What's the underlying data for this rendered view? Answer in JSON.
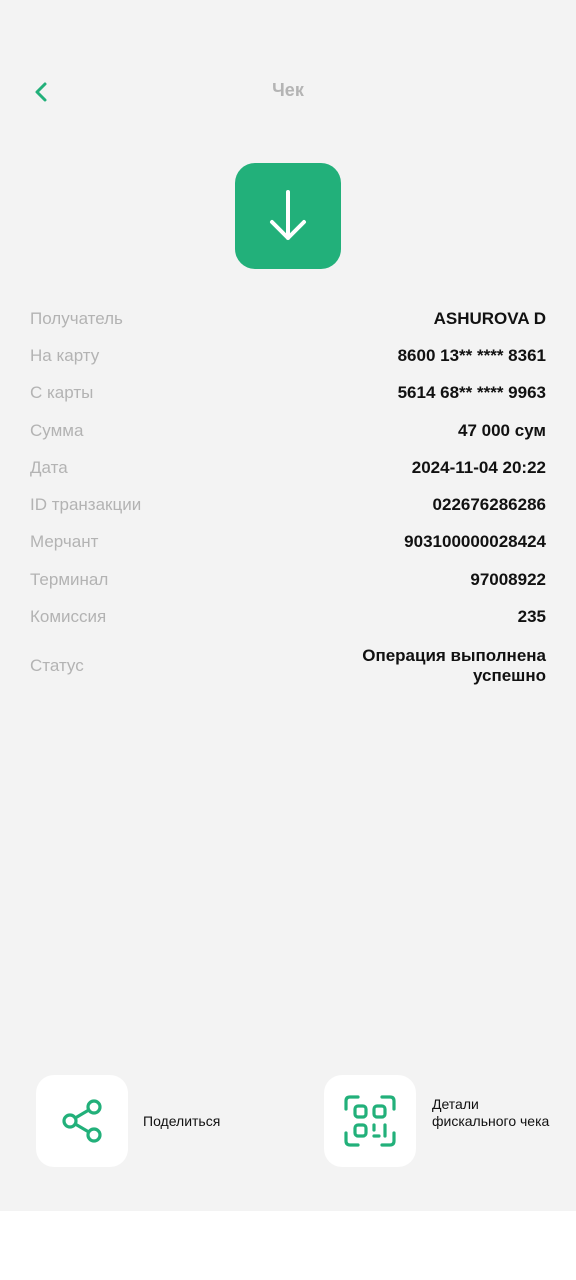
{
  "header": {
    "title": "Чек"
  },
  "details": [
    {
      "label": "Получатель",
      "value": "ASHUROVA D"
    },
    {
      "label": "На карту",
      "value": "8600 13** **** 8361"
    },
    {
      "label": "С карты",
      "value": "5614 68** **** 9963"
    },
    {
      "label": "Сумма",
      "value": "47 000 сум"
    },
    {
      "label": "Дата",
      "value": "2024-11-04 20:22"
    },
    {
      "label": "ID транзакции",
      "value": "022676286286"
    },
    {
      "label": "Мерчант",
      "value": "903100000028424"
    },
    {
      "label": "Терминал",
      "value": "97008922"
    },
    {
      "label": "Комиссия",
      "value": "235"
    },
    {
      "label": "Статус",
      "value": "Операция выполнена успешно"
    }
  ],
  "actions": {
    "share_label": "Поделиться",
    "fiscal_label": "Детали фискального чека"
  },
  "icons": {
    "back": "chevron-left-icon",
    "status": "arrow-down-icon",
    "share": "share-icon",
    "fiscal": "qr-code-icon"
  },
  "colors": {
    "accent": "#22b07a",
    "background": "#f3f3f3"
  }
}
